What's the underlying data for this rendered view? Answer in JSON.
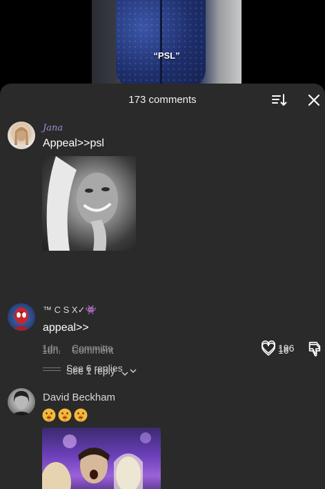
{
  "video": {
    "caption": "“PSL”"
  },
  "sheet": {
    "title": "173 comments"
  },
  "comments": [
    {
      "username": "Jana",
      "text": "Appeal>>psl",
      "time": "1dn.",
      "action": "Committs",
      "likes": "196",
      "replies_label": "See 6 replies"
    },
    {
      "username": "™ C S X✓👾",
      "text": "appeal>>",
      "time": "1dn.",
      "action": "Comment",
      "likes": "16",
      "replies_label": "See 1 reply"
    },
    {
      "username": "David Beckham",
      "emojis": [
        "shushing-face",
        "shushing-face",
        "shushing-face"
      ]
    }
  ],
  "icons": {
    "sort": "sort-icon",
    "close": "close-icon",
    "like": "heart-outline-icon",
    "dislike": "thumbs-down-icon"
  }
}
